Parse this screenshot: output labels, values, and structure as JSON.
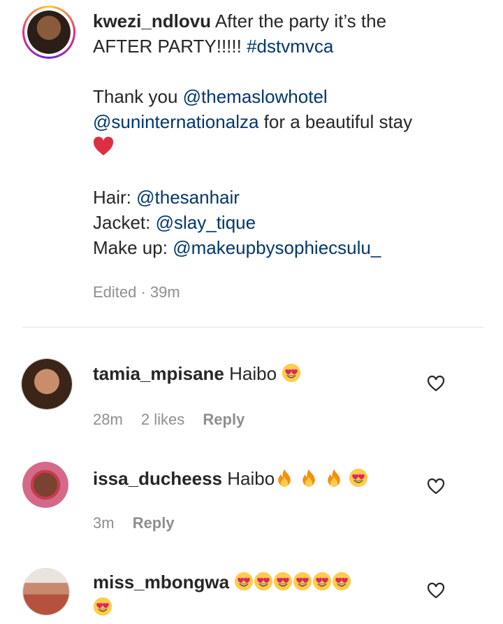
{
  "post": {
    "username": "kwezi_ndlovu",
    "caption_line1": "After the party it’s the",
    "caption_line2a": "AFTER PARTY!!!!!",
    "hashtag": "#dstvmvca",
    "thanks": "Thank you",
    "mention_hotel": "@themaslowhotel",
    "mention_sun": "@suninternationalza",
    "stay": "for a beautiful stay",
    "heart_emoji": "❤️",
    "hair_label": "Hair:",
    "hair_handle": "@thesanhair",
    "jacket_label": "Jacket:",
    "jacket_handle": "@slay_tique",
    "makeup_label": "Make up:",
    "makeup_handle": "@makeupbysophiecsulu_",
    "edited": "Edited · 39m"
  },
  "comments": [
    {
      "username": "tamia_mpisane",
      "text": "Haibo",
      "emoji": "heart-eyes",
      "time": "28m",
      "likes": "2 likes",
      "reply": "Reply"
    },
    {
      "username": "issa_ducheess",
      "text": "Haibo",
      "emoji": "fire-fire-fire-heart-eyes",
      "time": "3m",
      "reply": "Reply"
    },
    {
      "username": "miss_mbongwa",
      "text": "",
      "emoji": "heart-eyes-x7"
    }
  ],
  "colors": {
    "link": "#00376b",
    "meta": "#8e8e8e",
    "text": "#262626"
  }
}
